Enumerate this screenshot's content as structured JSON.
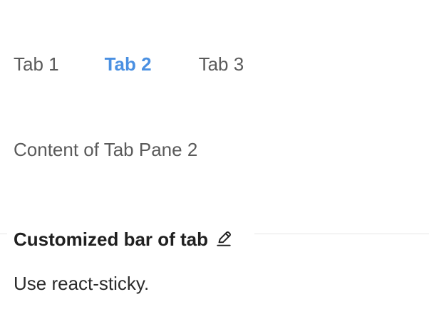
{
  "tabs": [
    {
      "label": "Tab 1",
      "active": false
    },
    {
      "label": "Tab 2",
      "active": true
    },
    {
      "label": "Tab 3",
      "active": false
    }
  ],
  "pane": {
    "content": "Content of Tab Pane 2"
  },
  "section": {
    "title": "Customized bar of tab",
    "edit_icon": "edit-icon",
    "description": "Use react-sticky."
  },
  "colors": {
    "active_tab": "#4a90e2",
    "text": "#5a5a5a",
    "title": "#202020"
  }
}
